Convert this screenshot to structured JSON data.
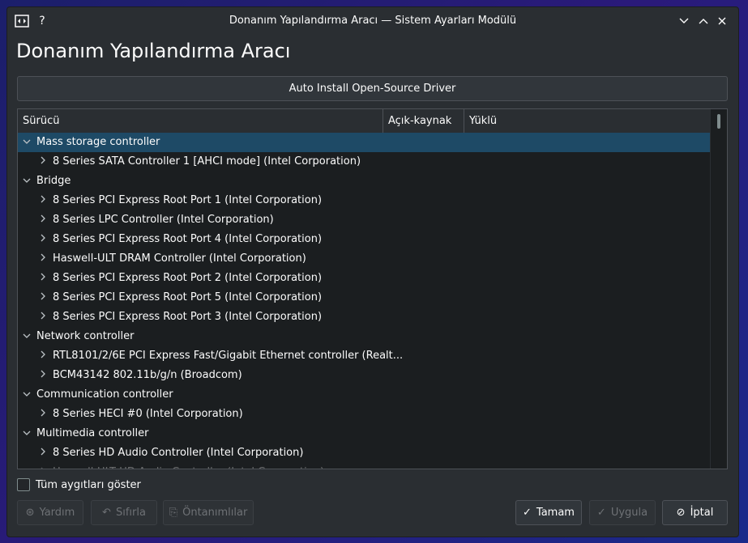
{
  "window": {
    "title": "Donanım Yapılandırma Aracı — Sistem Ayarları Modülü",
    "heading": "Donanım Yapılandırma Aracı"
  },
  "auto_install_label": "Auto Install Open-Source Driver",
  "tree": {
    "columns": [
      "Sürücü",
      "Açık-kaynak",
      "Yüklü"
    ],
    "rows": [
      {
        "level": 0,
        "label": "Mass storage controller",
        "expanded": true,
        "selected": true
      },
      {
        "level": 1,
        "label": "8 Series SATA Controller 1 [AHCI mode] (Intel Corporation)"
      },
      {
        "level": 0,
        "label": "Bridge",
        "expanded": true
      },
      {
        "level": 1,
        "label": "8 Series PCI Express Root Port 1 (Intel Corporation)"
      },
      {
        "level": 1,
        "label": "8 Series LPC Controller (Intel Corporation)"
      },
      {
        "level": 1,
        "label": "8 Series PCI Express Root Port 4 (Intel Corporation)"
      },
      {
        "level": 1,
        "label": "Haswell-ULT DRAM Controller (Intel Corporation)"
      },
      {
        "level": 1,
        "label": "8 Series PCI Express Root Port 2 (Intel Corporation)"
      },
      {
        "level": 1,
        "label": "8 Series PCI Express Root Port 5 (Intel Corporation)"
      },
      {
        "level": 1,
        "label": "8 Series PCI Express Root Port 3 (Intel Corporation)"
      },
      {
        "level": 0,
        "label": "Network controller",
        "expanded": true
      },
      {
        "level": 1,
        "label": "RTL8101/2/6E PCI Express Fast/Gigabit Ethernet controller (Realt..."
      },
      {
        "level": 1,
        "label": "BCM43142 802.11b/g/n (Broadcom)"
      },
      {
        "level": 0,
        "label": "Communication controller",
        "expanded": true
      },
      {
        "level": 1,
        "label": "8 Series HECI #0 (Intel Corporation)"
      },
      {
        "level": 0,
        "label": "Multimedia controller",
        "expanded": true
      },
      {
        "level": 1,
        "label": "8 Series HD Audio Controller (Intel Corporation)"
      },
      {
        "level": 1,
        "label": "Haswell-ULT HD Audio Controller (Intel Corporation)",
        "clipped": true
      }
    ]
  },
  "show_all_label": "Tüm aygıtları göster",
  "buttons": {
    "help": "Yardım",
    "reset": "Sıfırla",
    "defaults": "Öntanımlılar",
    "ok": "Tamam",
    "apply": "Uygula",
    "cancel": "İptal"
  },
  "icons": {
    "app": "hardware-icon",
    "help": "question-icon",
    "minimize": "chevron-down-icon",
    "maximize": "chevron-up-icon",
    "close": "close-icon",
    "expanded": "chevron-down-icon",
    "collapsed": "chevron-right-icon"
  }
}
